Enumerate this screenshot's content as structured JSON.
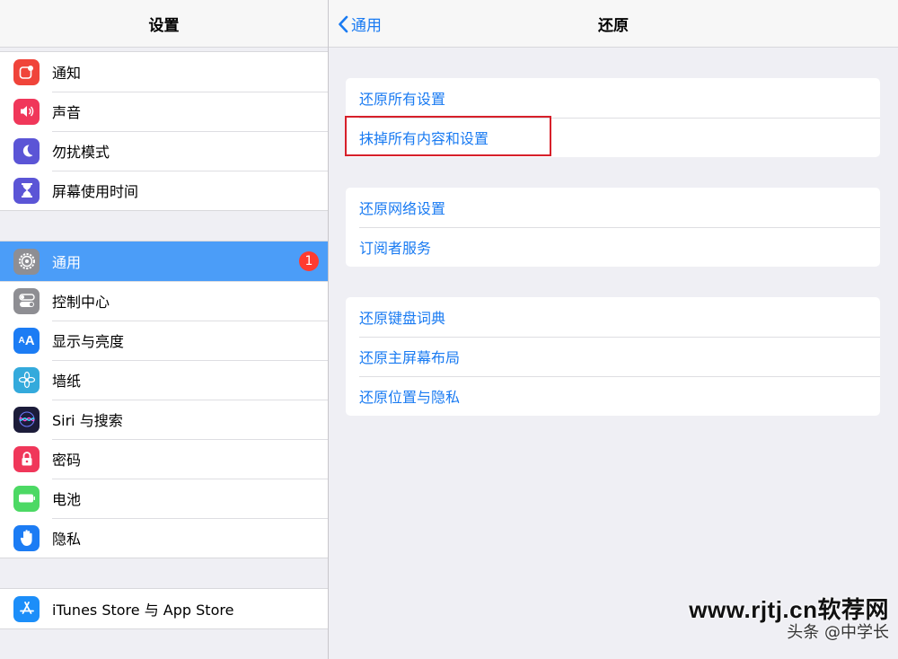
{
  "sidebar": {
    "title": "设置",
    "groups": [
      {
        "items": [
          {
            "label": "通知",
            "icon": "notifications-icon",
            "color": "#f0443a"
          },
          {
            "label": "声音",
            "icon": "sound-icon",
            "color": "#f0375a"
          },
          {
            "label": "勿扰模式",
            "icon": "moon-icon",
            "color": "#5b55d6"
          },
          {
            "label": "屏幕使用时间",
            "icon": "hourglass-icon",
            "color": "#5b55d6"
          }
        ]
      },
      {
        "items": [
          {
            "label": "通用",
            "icon": "gear-icon",
            "color": "#8e8e93",
            "badge": "1",
            "selected": true
          },
          {
            "label": "控制中心",
            "icon": "switches-icon",
            "color": "#8e8e93"
          },
          {
            "label": "显示与亮度",
            "icon": "text-size-icon",
            "color": "#1c7cf4"
          },
          {
            "label": "墙纸",
            "icon": "flower-icon",
            "color": "#34aadc"
          },
          {
            "label": "Siri 与搜索",
            "icon": "siri-icon",
            "color": "#1c1c3a"
          },
          {
            "label": "密码",
            "icon": "lock-icon",
            "color": "#f0375a"
          },
          {
            "label": "电池",
            "icon": "battery-icon",
            "color": "#4cd964"
          },
          {
            "label": "隐私",
            "icon": "hand-icon",
            "color": "#1c7cf4"
          }
        ]
      },
      {
        "items": [
          {
            "label": "iTunes Store 与 App Store",
            "icon": "app-store-icon",
            "color": "#1c8ef9"
          }
        ]
      }
    ]
  },
  "detail": {
    "back_label": "通用",
    "title": "还原",
    "groups": [
      {
        "items": [
          {
            "label": "还原所有设置"
          },
          {
            "label": "抹掉所有内容和设置"
          }
        ]
      },
      {
        "items": [
          {
            "label": "还原网络设置"
          },
          {
            "label": "订阅者服务"
          }
        ]
      },
      {
        "items": [
          {
            "label": "还原键盘词典"
          },
          {
            "label": "还原主屏幕布局"
          },
          {
            "label": "还原位置与隐私"
          }
        ]
      }
    ]
  },
  "watermark": {
    "line1": "www.rjtj.cn软荐网",
    "line2": "头条 @中学长"
  },
  "colors": {
    "accent": "#1a7bf2",
    "selected_row": "#4b9df8",
    "badge": "#ff3b30",
    "highlight": "#d7202a"
  }
}
